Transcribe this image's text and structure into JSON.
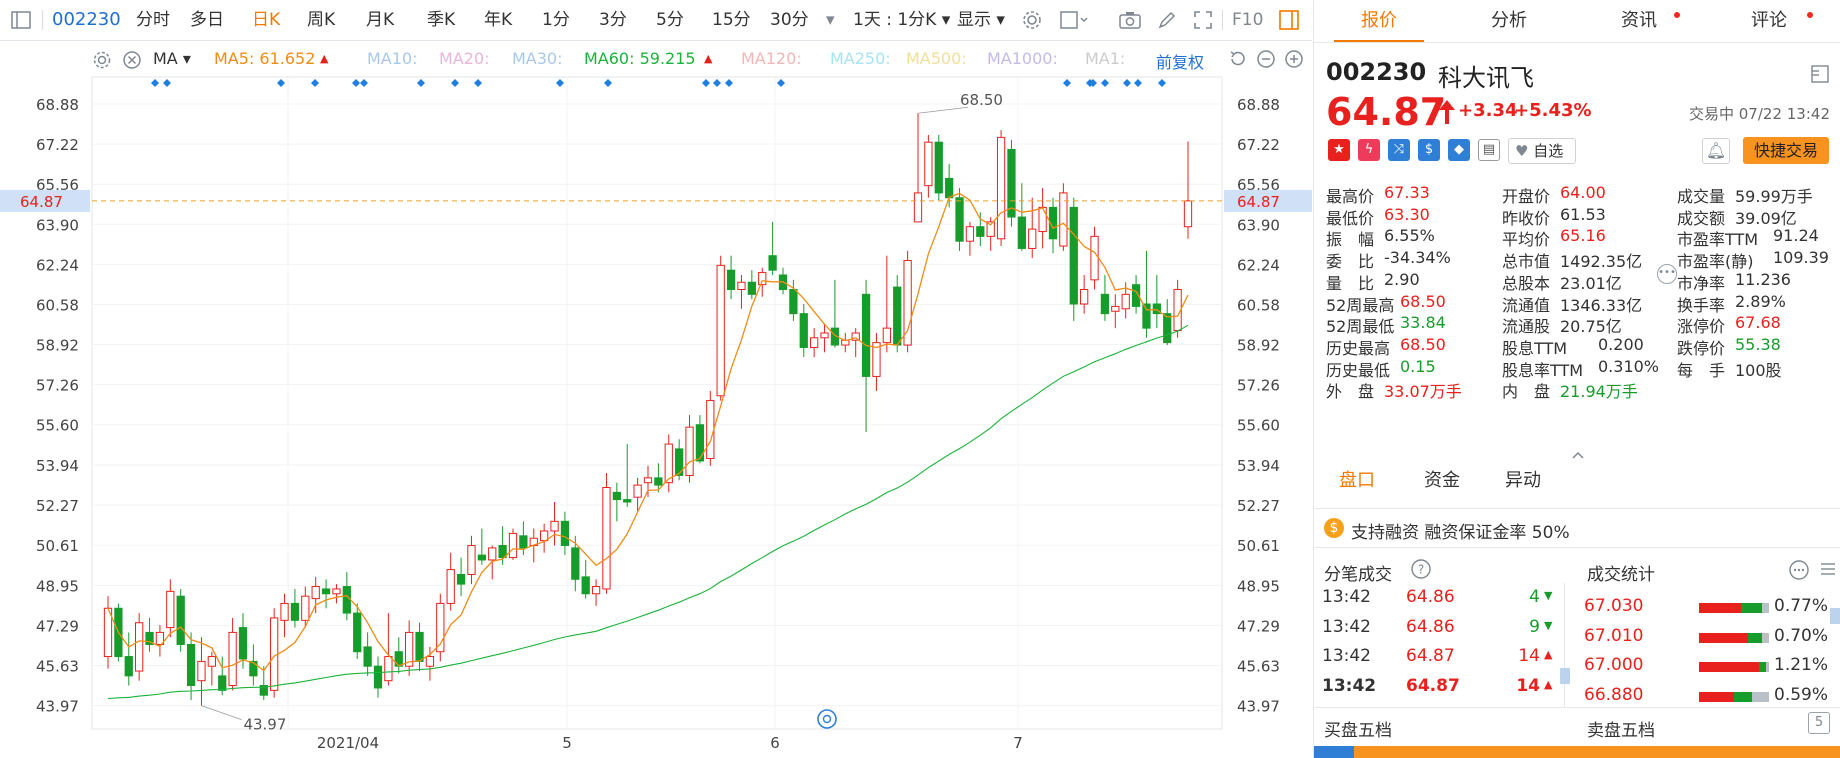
{
  "toolbar": {
    "code": "002230",
    "periods": [
      "分时",
      "多日",
      "日K",
      "周K",
      "月K",
      "季K",
      "年K",
      "1分",
      "3分",
      "5分",
      "15分",
      "30分"
    ],
    "active_period": "日K",
    "interval": "1天 : 1分K",
    "display": "显示",
    "f10": "F10"
  },
  "ma_bar": {
    "indicator": "MA",
    "items": [
      {
        "label": "MA5: 61.652",
        "color": "#f08c16"
      },
      {
        "label": "MA10:",
        "color": "#a8c8ea"
      },
      {
        "label": "MA20:",
        "color": "#e9b5d8"
      },
      {
        "label": "MA30:",
        "color": "#a8c8ea"
      },
      {
        "label": "MA60: 59.215",
        "color": "#1bb33b"
      },
      {
        "label": "MA120:",
        "color": "#f3b6b6"
      },
      {
        "label": "MA250:",
        "color": "#a7e3f1"
      },
      {
        "label": "MA500:",
        "color": "#f1e09a"
      },
      {
        "label": "MA1000:",
        "color": "#c6b9e8"
      },
      {
        "label": "MA1:",
        "color": "#cccccc"
      }
    ],
    "adjust": "前复权"
  },
  "chart": {
    "y_ticks": [
      "68.88",
      "67.22",
      "65.56",
      "63.90",
      "62.24",
      "60.58",
      "58.92",
      "57.26",
      "55.60",
      "53.94",
      "52.27",
      "50.61",
      "48.95",
      "47.29",
      "45.63",
      "43.97"
    ],
    "current_price": "64.87",
    "x_labels": [
      "2021/04",
      "5",
      "6",
      "7"
    ],
    "high_label": "68.50",
    "low_label": "43.97"
  },
  "chart_data": {
    "type": "candlestick",
    "ylim": [
      43.0,
      70.0
    ],
    "ma5_last": 61.652,
    "ma60_last": 59.215,
    "candles": [
      {
        "o": 46.0,
        "h": 48.5,
        "l": 45.5,
        "c": 48.0
      },
      {
        "o": 48.0,
        "h": 48.2,
        "l": 45.8,
        "c": 46.0
      },
      {
        "o": 46.0,
        "h": 47.0,
        "l": 44.8,
        "c": 45.2
      },
      {
        "o": 45.4,
        "h": 47.8,
        "l": 45.0,
        "c": 47.4
      },
      {
        "o": 47.0,
        "h": 47.6,
        "l": 46.2,
        "c": 46.5
      },
      {
        "o": 46.5,
        "h": 47.3,
        "l": 46.0,
        "c": 47.0
      },
      {
        "o": 47.2,
        "h": 49.2,
        "l": 46.8,
        "c": 48.7
      },
      {
        "o": 48.5,
        "h": 48.8,
        "l": 46.2,
        "c": 46.5
      },
      {
        "o": 46.5,
        "h": 47.0,
        "l": 44.2,
        "c": 44.8
      },
      {
        "o": 45.0,
        "h": 46.8,
        "l": 43.97,
        "c": 45.8
      },
      {
        "o": 45.6,
        "h": 46.2,
        "l": 44.8,
        "c": 46.0
      },
      {
        "o": 45.2,
        "h": 46.0,
        "l": 44.4,
        "c": 44.6
      },
      {
        "o": 44.8,
        "h": 47.6,
        "l": 44.6,
        "c": 47.0
      },
      {
        "o": 47.2,
        "h": 47.8,
        "l": 45.5,
        "c": 45.9
      },
      {
        "o": 45.8,
        "h": 46.5,
        "l": 44.8,
        "c": 45.2
      },
      {
        "o": 44.8,
        "h": 45.6,
        "l": 44.2,
        "c": 44.4
      },
      {
        "o": 44.6,
        "h": 48.0,
        "l": 44.3,
        "c": 47.6
      },
      {
        "o": 47.5,
        "h": 48.6,
        "l": 46.8,
        "c": 48.2
      },
      {
        "o": 48.2,
        "h": 48.8,
        "l": 47.2,
        "c": 47.5
      },
      {
        "o": 47.5,
        "h": 48.9,
        "l": 47.2,
        "c": 48.5
      },
      {
        "o": 48.4,
        "h": 49.3,
        "l": 47.8,
        "c": 48.9
      },
      {
        "o": 48.8,
        "h": 49.2,
        "l": 48.0,
        "c": 48.6
      },
      {
        "o": 48.6,
        "h": 49.0,
        "l": 48.2,
        "c": 48.8
      },
      {
        "o": 48.9,
        "h": 49.5,
        "l": 47.5,
        "c": 47.8
      },
      {
        "o": 47.8,
        "h": 48.2,
        "l": 45.9,
        "c": 46.2
      },
      {
        "o": 46.4,
        "h": 47.0,
        "l": 45.2,
        "c": 45.6
      },
      {
        "o": 45.6,
        "h": 46.0,
        "l": 44.3,
        "c": 44.7
      },
      {
        "o": 45.0,
        "h": 47.8,
        "l": 44.8,
        "c": 46.0
      },
      {
        "o": 46.2,
        "h": 46.8,
        "l": 45.3,
        "c": 45.6
      },
      {
        "o": 45.6,
        "h": 47.5,
        "l": 45.2,
        "c": 47.0
      },
      {
        "o": 47.0,
        "h": 47.4,
        "l": 45.4,
        "c": 45.8
      },
      {
        "o": 45.6,
        "h": 46.4,
        "l": 45.0,
        "c": 46.0
      },
      {
        "o": 46.2,
        "h": 48.6,
        "l": 45.8,
        "c": 48.2
      },
      {
        "o": 48.2,
        "h": 50.3,
        "l": 47.9,
        "c": 49.6
      },
      {
        "o": 49.4,
        "h": 50.1,
        "l": 48.5,
        "c": 49.0
      },
      {
        "o": 49.4,
        "h": 51.0,
        "l": 49.0,
        "c": 50.6
      },
      {
        "o": 50.2,
        "h": 51.3,
        "l": 49.8,
        "c": 50.0
      },
      {
        "o": 50.0,
        "h": 50.6,
        "l": 49.2,
        "c": 50.5
      },
      {
        "o": 50.6,
        "h": 51.4,
        "l": 49.8,
        "c": 50.1
      },
      {
        "o": 50.1,
        "h": 51.3,
        "l": 50.0,
        "c": 51.1
      },
      {
        "o": 51.0,
        "h": 51.6,
        "l": 50.2,
        "c": 50.5
      },
      {
        "o": 50.6,
        "h": 51.3,
        "l": 49.9,
        "c": 50.9
      },
      {
        "o": 50.8,
        "h": 51.5,
        "l": 50.3,
        "c": 51.2
      },
      {
        "o": 51.2,
        "h": 52.4,
        "l": 50.6,
        "c": 51.6
      },
      {
        "o": 51.6,
        "h": 52.0,
        "l": 50.2,
        "c": 50.6
      },
      {
        "o": 50.5,
        "h": 51.0,
        "l": 48.7,
        "c": 49.2
      },
      {
        "o": 49.3,
        "h": 50.0,
        "l": 48.4,
        "c": 48.6
      },
      {
        "o": 48.6,
        "h": 49.2,
        "l": 48.1,
        "c": 48.9
      },
      {
        "o": 48.8,
        "h": 53.6,
        "l": 48.6,
        "c": 53.0
      },
      {
        "o": 52.8,
        "h": 53.2,
        "l": 51.6,
        "c": 52.5
      },
      {
        "o": 52.5,
        "h": 54.8,
        "l": 52.2,
        "c": 52.4
      },
      {
        "o": 52.6,
        "h": 53.4,
        "l": 52.0,
        "c": 53.1
      },
      {
        "o": 53.2,
        "h": 53.9,
        "l": 52.6,
        "c": 53.4
      },
      {
        "o": 53.4,
        "h": 54.0,
        "l": 52.8,
        "c": 53.1
      },
      {
        "o": 53.2,
        "h": 55.2,
        "l": 52.8,
        "c": 54.8
      },
      {
        "o": 54.6,
        "h": 55.0,
        "l": 53.3,
        "c": 53.5
      },
      {
        "o": 53.5,
        "h": 56.0,
        "l": 53.2,
        "c": 55.5
      },
      {
        "o": 55.6,
        "h": 56.0,
        "l": 54.0,
        "c": 54.1
      },
      {
        "o": 54.2,
        "h": 57.0,
        "l": 53.9,
        "c": 56.6
      },
      {
        "o": 56.8,
        "h": 62.6,
        "l": 56.6,
        "c": 62.2
      },
      {
        "o": 62.0,
        "h": 62.6,
        "l": 60.8,
        "c": 61.2
      },
      {
        "o": 61.2,
        "h": 61.8,
        "l": 60.4,
        "c": 61.5
      },
      {
        "o": 61.5,
        "h": 62.0,
        "l": 60.8,
        "c": 61.0
      },
      {
        "o": 61.4,
        "h": 62.1,
        "l": 60.9,
        "c": 61.9
      },
      {
        "o": 62.6,
        "h": 64.0,
        "l": 61.8,
        "c": 62.0
      },
      {
        "o": 61.8,
        "h": 62.1,
        "l": 61.0,
        "c": 61.2
      },
      {
        "o": 61.2,
        "h": 61.6,
        "l": 59.9,
        "c": 60.2
      },
      {
        "o": 60.2,
        "h": 60.6,
        "l": 58.4,
        "c": 58.8
      },
      {
        "o": 58.8,
        "h": 59.6,
        "l": 58.4,
        "c": 59.2
      },
      {
        "o": 59.2,
        "h": 59.8,
        "l": 58.6,
        "c": 59.4
      },
      {
        "o": 59.6,
        "h": 61.6,
        "l": 58.8,
        "c": 58.9
      },
      {
        "o": 58.9,
        "h": 59.4,
        "l": 58.6,
        "c": 59.1
      },
      {
        "o": 59.1,
        "h": 59.6,
        "l": 58.4,
        "c": 59.4
      },
      {
        "o": 61.0,
        "h": 61.6,
        "l": 55.3,
        "c": 57.6
      },
      {
        "o": 57.6,
        "h": 59.4,
        "l": 57.0,
        "c": 59.0
      },
      {
        "o": 59.0,
        "h": 62.6,
        "l": 58.6,
        "c": 59.6
      },
      {
        "o": 61.3,
        "h": 61.8,
        "l": 58.6,
        "c": 58.9
      },
      {
        "o": 58.9,
        "h": 62.8,
        "l": 58.6,
        "c": 62.4
      },
      {
        "o": 64.0,
        "h": 68.5,
        "l": 64.0,
        "c": 65.2
      },
      {
        "o": 65.5,
        "h": 67.6,
        "l": 65.0,
        "c": 67.3
      },
      {
        "o": 67.3,
        "h": 67.6,
        "l": 64.9,
        "c": 65.2
      },
      {
        "o": 65.8,
        "h": 66.4,
        "l": 64.6,
        "c": 65.0
      },
      {
        "o": 65.0,
        "h": 65.4,
        "l": 62.8,
        "c": 63.2
      },
      {
        "o": 63.2,
        "h": 64.0,
        "l": 62.6,
        "c": 63.8
      },
      {
        "o": 63.8,
        "h": 64.4,
        "l": 63.0,
        "c": 63.4
      },
      {
        "o": 63.4,
        "h": 64.2,
        "l": 62.8,
        "c": 64.0
      },
      {
        "o": 63.3,
        "h": 67.8,
        "l": 63.0,
        "c": 67.5
      },
      {
        "o": 67.0,
        "h": 67.4,
        "l": 63.8,
        "c": 64.2
      },
      {
        "o": 64.2,
        "h": 65.6,
        "l": 62.8,
        "c": 62.9
      },
      {
        "o": 62.9,
        "h": 65.0,
        "l": 62.5,
        "c": 63.7
      },
      {
        "o": 63.6,
        "h": 65.4,
        "l": 62.9,
        "c": 64.6
      },
      {
        "o": 64.6,
        "h": 65.0,
        "l": 62.7,
        "c": 63.3
      },
      {
        "o": 63.0,
        "h": 65.6,
        "l": 62.8,
        "c": 65.2
      },
      {
        "o": 64.6,
        "h": 65.0,
        "l": 59.9,
        "c": 60.6
      },
      {
        "o": 60.6,
        "h": 61.8,
        "l": 60.2,
        "c": 61.2
      },
      {
        "o": 61.6,
        "h": 63.8,
        "l": 61.2,
        "c": 63.4
      },
      {
        "o": 61.0,
        "h": 61.8,
        "l": 59.9,
        "c": 60.2
      },
      {
        "o": 60.3,
        "h": 61.0,
        "l": 59.6,
        "c": 60.5
      },
      {
        "o": 60.4,
        "h": 61.5,
        "l": 60.0,
        "c": 61.0
      },
      {
        "o": 61.4,
        "h": 61.8,
        "l": 60.2,
        "c": 60.5
      },
      {
        "o": 60.6,
        "h": 62.8,
        "l": 59.2,
        "c": 59.6
      },
      {
        "o": 60.6,
        "h": 61.8,
        "l": 59.6,
        "c": 60.2
      },
      {
        "o": 60.2,
        "h": 60.8,
        "l": 58.9,
        "c": 59.0
      },
      {
        "o": 59.5,
        "h": 61.6,
        "l": 59.2,
        "c": 61.2
      },
      {
        "o": 63.8,
        "h": 67.33,
        "l": 63.3,
        "c": 64.87
      }
    ]
  },
  "panel": {
    "tabs": [
      "报价",
      "分析",
      "资讯",
      "评论"
    ],
    "active_tab": "报价",
    "code": "002230",
    "name": "科大讯飞",
    "price": "64.87",
    "change": "+3.34",
    "change_pct": "+5.43%",
    "status": "交易中 07/22 13:42",
    "watch_label": "自选",
    "trade_label": "快捷交易",
    "stats": [
      [
        {
          "k": "最高价",
          "v": "67.33",
          "c": "red"
        },
        {
          "k": "开盘价",
          "v": "64.00",
          "c": "red"
        },
        {
          "k": "成交量",
          "v": "59.99万手",
          "c": ""
        }
      ],
      [
        {
          "k": "最低价",
          "v": "63.30",
          "c": "red"
        },
        {
          "k": "昨收价",
          "v": "61.53",
          "c": ""
        },
        {
          "k": "成交额",
          "v": "39.09亿",
          "c": ""
        }
      ],
      [
        {
          "k": "振　幅",
          "v": "6.55%",
          "c": ""
        },
        {
          "k": "平均价",
          "v": "65.16",
          "c": "red"
        },
        {
          "k": "市盈率TTM",
          "v": "91.24",
          "c": ""
        }
      ],
      [
        {
          "k": "委　比",
          "v": "-34.34%",
          "c": ""
        },
        {
          "k": "总市值",
          "v": "1492.35亿",
          "c": ""
        },
        {
          "k": "市盈率(静)",
          "v": "109.39",
          "c": ""
        }
      ],
      [
        {
          "k": "量　比",
          "v": "2.90",
          "c": ""
        },
        {
          "k": "总股本",
          "v": "23.01亿",
          "c": ""
        },
        {
          "k": "市净率",
          "v": "11.236",
          "c": ""
        }
      ],
      [
        {
          "k": "52周最高",
          "v": "68.50",
          "c": "red"
        },
        {
          "k": "流通值",
          "v": "1346.33亿",
          "c": ""
        },
        {
          "k": "换手率",
          "v": "2.89%",
          "c": ""
        }
      ],
      [
        {
          "k": "52周最低",
          "v": "33.84",
          "c": "green"
        },
        {
          "k": "流通股",
          "v": "20.75亿",
          "c": ""
        },
        {
          "k": "涨停价",
          "v": "67.68",
          "c": "red"
        }
      ],
      [
        {
          "k": "历史最高",
          "v": "68.50",
          "c": "red"
        },
        {
          "k": "股息TTM",
          "v": "0.200",
          "c": ""
        },
        {
          "k": "跌停价",
          "v": "55.38",
          "c": "green"
        }
      ],
      [
        {
          "k": "历史最低",
          "v": "0.15",
          "c": "green"
        },
        {
          "k": "股息率TTM",
          "v": "0.310%",
          "c": ""
        },
        {
          "k": "每　手",
          "v": "100股",
          "c": ""
        }
      ],
      [
        {
          "k": "外　盘",
          "v": "33.07万手",
          "c": "red"
        },
        {
          "k": "内　盘",
          "v": "21.94万手",
          "c": "green"
        }
      ]
    ],
    "subtabs": [
      "盘口",
      "资金",
      "异动"
    ],
    "margin_text": "支持融资 融资保证金率 50%",
    "tick_title": "分笔成交",
    "ticks": [
      {
        "t": "13:42",
        "p": "64.86",
        "v": "4",
        "dir": "down"
      },
      {
        "t": "13:42",
        "p": "64.86",
        "v": "9",
        "dir": "down"
      },
      {
        "t": "13:42",
        "p": "64.87",
        "v": "14",
        "dir": "up"
      },
      {
        "t": "13:42",
        "p": "64.87",
        "v": "14",
        "dir": "up"
      }
    ],
    "volstat_title": "成交统计",
    "volstats": [
      {
        "p": "67.030",
        "pct": "0.77%",
        "r": 0.6,
        "g": 0.3
      },
      {
        "p": "67.010",
        "pct": "0.70%",
        "r": 0.7,
        "g": 0.2
      },
      {
        "p": "67.000",
        "pct": "1.21%",
        "r": 0.85,
        "g": 0.1
      },
      {
        "p": "66.880",
        "pct": "0.59%",
        "r": 0.5,
        "g": 0.25
      }
    ],
    "bid_title": "买盘五档",
    "ask_title": "卖盘五档"
  }
}
